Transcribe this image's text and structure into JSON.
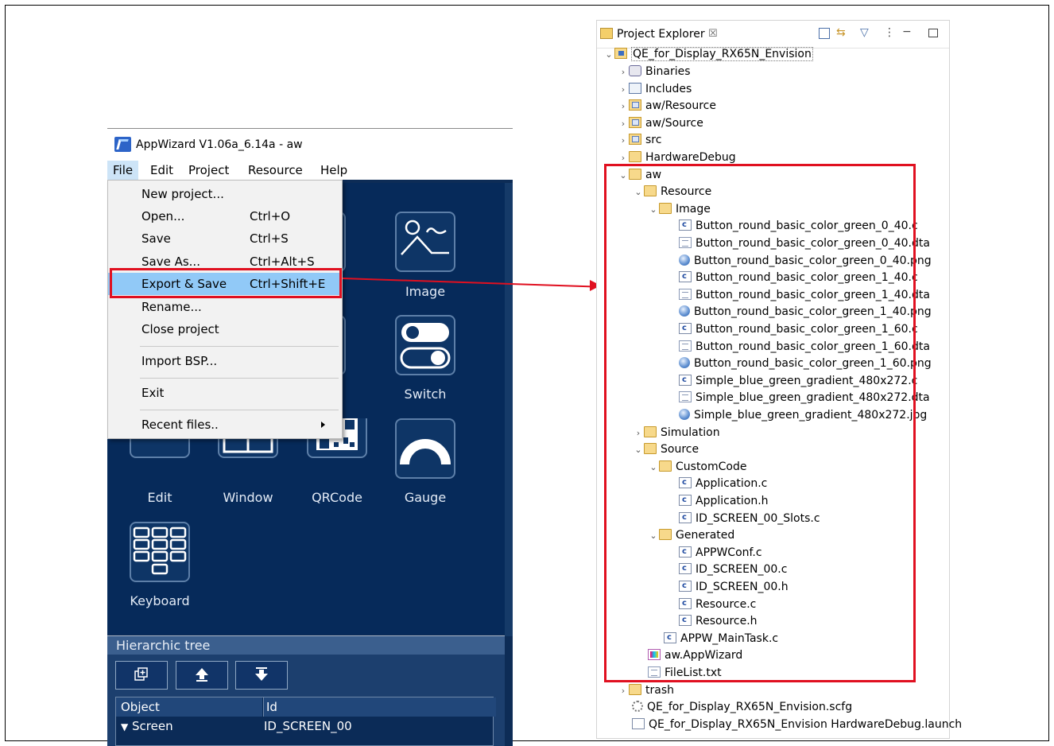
{
  "appwizard": {
    "title": "AppWizard V1.06a_6.14a - aw",
    "menubar": [
      "File",
      "Edit",
      "Project",
      "Resource",
      "Help"
    ],
    "file_menu": [
      {
        "label": "New project...",
        "shortcut": ""
      },
      {
        "label": "Open...",
        "shortcut": "Ctrl+O"
      },
      {
        "label": "Save",
        "shortcut": "Ctrl+S"
      },
      {
        "label": "Save As...",
        "shortcut": "Ctrl+Alt+S"
      },
      {
        "label": "Export & Save",
        "shortcut": "Ctrl+Shift+E"
      },
      {
        "label": "Rename...",
        "shortcut": ""
      },
      {
        "label": "Close project",
        "shortcut": ""
      },
      {
        "label": "Import BSP...",
        "shortcut": ""
      },
      {
        "label": "Exit",
        "shortcut": ""
      },
      {
        "label": "Recent files..",
        "shortcut": ""
      }
    ],
    "tiles": {
      "button_partial": "on",
      "image": "Image",
      "library_partial": "ary",
      "switch": "Switch",
      "edit": "Edit",
      "window": "Window",
      "qrcode": "QRCode",
      "gauge": "Gauge",
      "keyboard": "Keyboard"
    },
    "hierarchic_tree": {
      "title": "Hierarchic tree",
      "col_object": "Object",
      "col_id": "Id",
      "row_object": "Screen",
      "row_id": "ID_SCREEN_00"
    }
  },
  "project_explorer": {
    "tab_title": "Project Explorer",
    "items": [
      "QE_for_Display_RX65N_Envision",
      "Binaries",
      "Includes",
      "aw/Resource",
      "aw/Source",
      "src",
      "HardwareDebug",
      "aw",
      "Resource",
      "Image",
      "Button_round_basic_color_green_0_40.c",
      "Button_round_basic_color_green_0_40.dta",
      "Button_round_basic_color_green_0_40.png",
      "Button_round_basic_color_green_1_40.c",
      "Button_round_basic_color_green_1_40.dta",
      "Button_round_basic_color_green_1_40.png",
      "Button_round_basic_color_green_1_60.c",
      "Button_round_basic_color_green_1_60.dta",
      "Button_round_basic_color_green_1_60.png",
      "Simple_blue_green_gradient_480x272.c",
      "Simple_blue_green_gradient_480x272.dta",
      "Simple_blue_green_gradient_480x272.jpg",
      "Simulation",
      "Source",
      "CustomCode",
      "Application.c",
      "Application.h",
      "ID_SCREEN_00_Slots.c",
      "Generated",
      "APPWConf.c",
      "ID_SCREEN_00.c",
      "ID_SCREEN_00.h",
      "Resource.c",
      "Resource.h",
      "APPW_MainTask.c",
      "aw.AppWizard",
      "FileList.txt",
      "trash",
      "QE_for_Display_RX65N_Envision.scfg",
      "QE_for_Display_RX65N_Envision HardwareDebug.launch"
    ]
  },
  "colors": {
    "annotation": "#e01020",
    "appwizard_bg": "#062a5a",
    "menu_highlight": "#91c9f7"
  }
}
